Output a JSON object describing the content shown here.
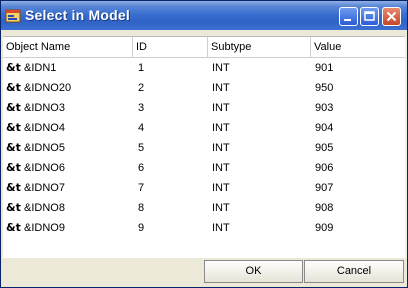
{
  "window": {
    "title": "Select in Model"
  },
  "table": {
    "columns": [
      "Object Name",
      "ID",
      "Subtype",
      "Value"
    ],
    "row_icon": "&t",
    "rows": [
      {
        "name": "&IDN1",
        "id": "1",
        "subtype": "INT",
        "value": "901"
      },
      {
        "name": "&IDNO20",
        "id": "2",
        "subtype": "INT",
        "value": "950"
      },
      {
        "name": "&IDNO3",
        "id": "3",
        "subtype": "INT",
        "value": "903"
      },
      {
        "name": "&IDNO4",
        "id": "4",
        "subtype": "INT",
        "value": "904"
      },
      {
        "name": "&IDNO5",
        "id": "5",
        "subtype": "INT",
        "value": "905"
      },
      {
        "name": "&IDNO6",
        "id": "6",
        "subtype": "INT",
        "value": "906"
      },
      {
        "name": "&IDNO7",
        "id": "7",
        "subtype": "INT",
        "value": "907"
      },
      {
        "name": "&IDNO8",
        "id": "8",
        "subtype": "INT",
        "value": "908"
      },
      {
        "name": "&IDNO9",
        "id": "9",
        "subtype": "INT",
        "value": "909"
      }
    ]
  },
  "buttons": {
    "ok": "OK",
    "cancel": "Cancel"
  },
  "icons": {
    "app": "app-icon",
    "minimize": "minimize-icon",
    "maximize": "maximize-icon",
    "close": "close-icon",
    "variable": "ampersand-t-icon"
  },
  "colors": {
    "titlebar": "#2f62c6",
    "close_button": "#c4462a",
    "dialog_bg": "#ece9d8"
  }
}
